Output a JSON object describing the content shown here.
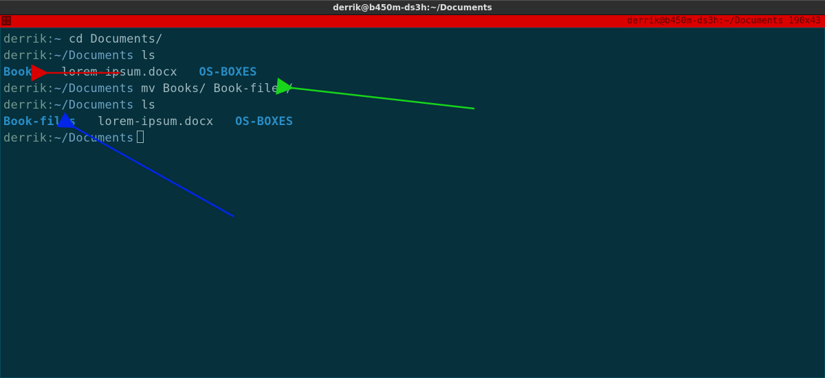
{
  "titlebar": {
    "title": "derrik@b450m-ds3h:~/Documents"
  },
  "statusbar": {
    "right_text": "derrik@b450m-ds3h:~/Documents 190x43"
  },
  "terminal": {
    "lines": [
      {
        "user": "derrik",
        "colon": ":",
        "path_tilde": "~",
        "path_rest": "",
        "cmd": " cd Documents/"
      },
      {
        "user": "derrik",
        "colon": ":",
        "path_tilde": "~",
        "path_rest": "/Documents",
        "cmd": " ls"
      },
      {
        "ls_entries": [
          {
            "name": "Books",
            "type": "dir"
          },
          {
            "name": "lorem-ipsum.docx",
            "type": "file"
          },
          {
            "name": "OS-BOXES",
            "type": "dir"
          }
        ]
      },
      {
        "user": "derrik",
        "colon": ":",
        "path_tilde": "~",
        "path_rest": "/Documents",
        "cmd": " mv Books/ Book-files/"
      },
      {
        "user": "derrik",
        "colon": ":",
        "path_tilde": "~",
        "path_rest": "/Documents",
        "cmd": " ls"
      },
      {
        "ls_entries": [
          {
            "name": "Book-files",
            "type": "dir"
          },
          {
            "name": "lorem-ipsum.docx",
            "type": "file"
          },
          {
            "name": "OS-BOXES",
            "type": "dir"
          }
        ]
      },
      {
        "user": "derrik",
        "colon": ":",
        "path_tilde": "~",
        "path_rest": "/Documents",
        "cmd": "",
        "cursor": true
      }
    ]
  },
  "annotations": {
    "red_arrow": {
      "description": "points to Books in first ls output"
    },
    "green_arrow": {
      "description": "points to mv command line"
    },
    "blue_arrow": {
      "description": "points to Book-files in second ls output"
    }
  },
  "colors": {
    "term_bg": "#05303c",
    "dir": "#2a8dc5",
    "user": "#74998f",
    "path": "#6fa2c2",
    "red": "#d90000",
    "green": "#18d41a",
    "blue": "#0225e8"
  }
}
